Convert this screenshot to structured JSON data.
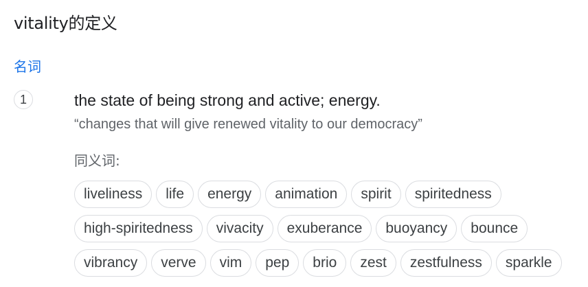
{
  "entry": {
    "headword": "vitality的定义",
    "part_of_speech": "名词",
    "senses": [
      {
        "number": "1",
        "definition": "the state of being strong and active; energy.",
        "example": "“changes that will give renewed vitality to our democracy”",
        "synonyms_label": "同义词:",
        "synonyms": [
          "liveliness",
          "life",
          "energy",
          "animation",
          "spirit",
          "spiritedness",
          "high-spiritedness",
          "vivacity",
          "exuberance",
          "buoyancy",
          "bounce",
          "vibrancy",
          "verve",
          "vim",
          "pep",
          "brio",
          "zest",
          "zestfulness",
          "sparkle"
        ]
      }
    ]
  }
}
